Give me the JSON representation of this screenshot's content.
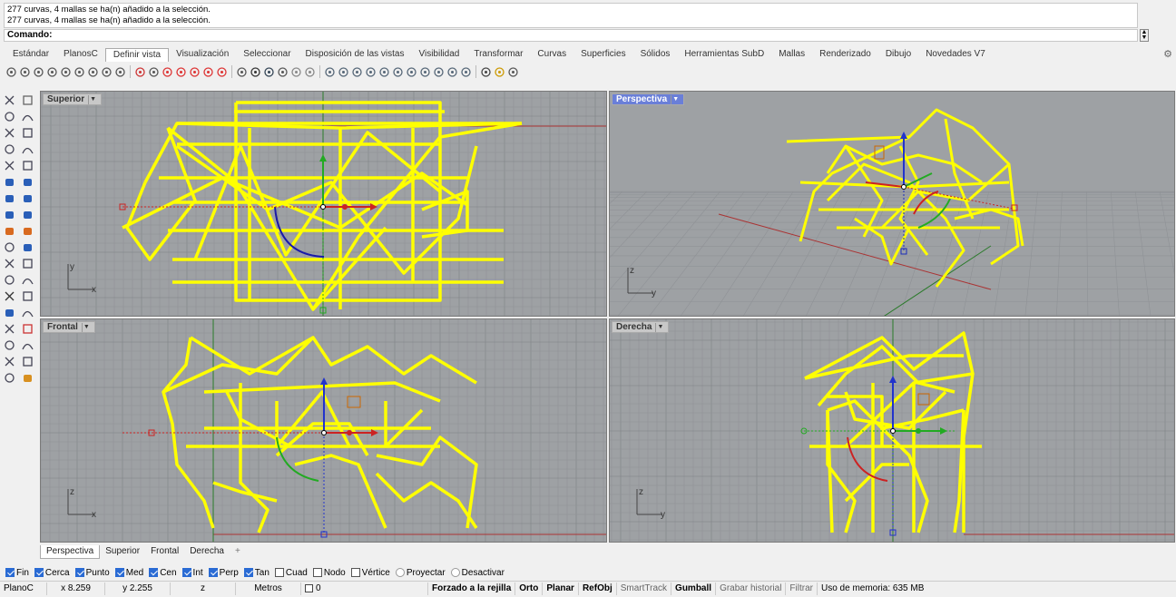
{
  "command": {
    "history": [
      "277 curvas, 4 mallas se ha(n) añadido a la selección.",
      "277 curvas, 4 mallas se ha(n) añadido a la selección."
    ],
    "prompt": "Comando:"
  },
  "tabs": [
    "Estándar",
    "PlanosC",
    "Definir vista",
    "Visualización",
    "Seleccionar",
    "Disposición de las vistas",
    "Visibilidad",
    "Transformar",
    "Curvas",
    "Superficies",
    "Sólidos",
    "Herramientas SubD",
    "Mallas",
    "Renderizado",
    "Dibujo",
    "Novedades V7"
  ],
  "active_tab": "Definir vista",
  "viewports": {
    "top": {
      "label": "Superior"
    },
    "perspective": {
      "label": "Perspectiva"
    },
    "front": {
      "label": "Frontal"
    },
    "right": {
      "label": "Derecha"
    }
  },
  "axis_labels": {
    "x": "x",
    "y": "y",
    "z": "z"
  },
  "viewport_tabs": [
    "Perspectiva",
    "Superior",
    "Frontal",
    "Derecha"
  ],
  "viewport_tab_add": "+",
  "osnaps": [
    {
      "label": "Fin",
      "checked": true
    },
    {
      "label": "Cerca",
      "checked": true
    },
    {
      "label": "Punto",
      "checked": true
    },
    {
      "label": "Med",
      "checked": true
    },
    {
      "label": "Cen",
      "checked": true
    },
    {
      "label": "Int",
      "checked": true
    },
    {
      "label": "Perp",
      "checked": true
    },
    {
      "label": "Tan",
      "checked": true
    },
    {
      "label": "Cuad",
      "checked": false
    },
    {
      "label": "Nodo",
      "checked": false
    },
    {
      "label": "Vértice",
      "checked": false
    },
    {
      "label": "Proyectar",
      "checked": false
    },
    {
      "label": "Desactivar",
      "checked": false
    }
  ],
  "status": {
    "plane": "PlanoC",
    "x": "x 8.259",
    "y": "y 2.255",
    "z": "z",
    "units": "Metros",
    "layer": "0",
    "grid_snap": "Forzado a la rejilla",
    "ortho": "Orto",
    "planar": "Planar",
    "refobj": "RefObj",
    "smarttrack": "SmartTrack",
    "gumball": "Gumball",
    "history": "Grabar historial",
    "filter": "Filtrar",
    "memory": "Uso de memoria: 635 MB"
  },
  "colors": {
    "wire": "#ffff00",
    "grid": "#8f9296",
    "grid_major": "#7f8286",
    "viewport_bg": "#9ea1a4",
    "active_label": "#6a7fd8",
    "x_axis": "#cc2222",
    "y_axis": "#22aa22",
    "z_axis": "#2233cc"
  }
}
